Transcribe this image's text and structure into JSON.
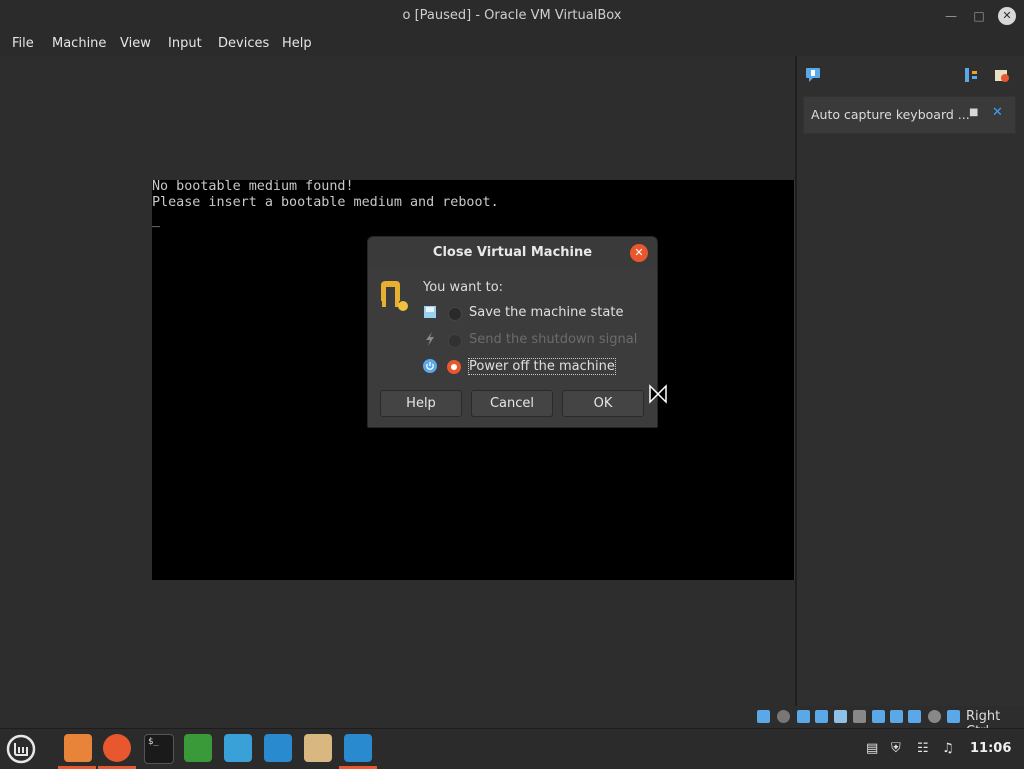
{
  "window": {
    "title": "o [Paused] - Oracle VM VirtualBox"
  },
  "menu": [
    "File",
    "Machine",
    "View",
    "Input",
    "Devices",
    "Help"
  ],
  "vm": {
    "line1": "No bootable medium found!",
    "line2": "Please insert a bootable medium and reboot.",
    "cursor": "_"
  },
  "notification": {
    "text": "Auto capture keyboard ..."
  },
  "dialog": {
    "title": "Close Virtual Machine",
    "prompt": "You want to:",
    "options": [
      {
        "label": "Save the machine state",
        "selected": false,
        "enabled": true
      },
      {
        "label": "Send the shutdown signal",
        "selected": false,
        "enabled": false
      },
      {
        "label": "Power off the machine",
        "selected": true,
        "enabled": true
      }
    ],
    "buttons": {
      "help": "Help",
      "cancel": "Cancel",
      "ok": "OK"
    }
  },
  "statusbar": {
    "host_key": "Right Ctrl"
  },
  "taskbar": {
    "clock": "11:06"
  },
  "colors": {
    "accent": "#e8572e",
    "link_blue": "#3ea0ff"
  }
}
